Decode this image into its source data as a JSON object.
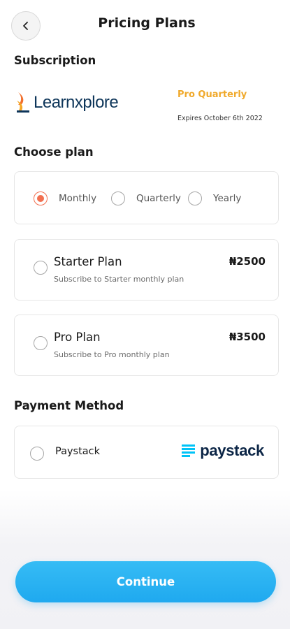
{
  "header": {
    "title": "Pricing Plans",
    "back_icon": "chevron-left-icon"
  },
  "subscription": {
    "section_label": "Subscription",
    "brand_name": "Learnxplore",
    "plan_name": "Pro Quarterly",
    "expiry": "Expires October 6th 2022"
  },
  "choose_plan": {
    "section_label": "Choose plan",
    "frequencies": [
      {
        "label": "Monthly",
        "selected": true
      },
      {
        "label": "Quarterly",
        "selected": false
      },
      {
        "label": "Yearly",
        "selected": false
      }
    ],
    "plans": [
      {
        "title": "Starter Plan",
        "description": "Subscribe to Starter monthly plan",
        "price": "₦2500",
        "selected": false
      },
      {
        "title": "Pro Plan",
        "description": "Subscribe to Pro monthly plan",
        "price": "₦3500",
        "selected": false
      }
    ]
  },
  "payment": {
    "section_label": "Payment Method",
    "method_label": "Paystack",
    "logo_text": "paystack",
    "selected": false
  },
  "footer": {
    "continue_label": "Continue"
  },
  "colors": {
    "accent_radio": "#f26f4f",
    "plan_highlight": "#f0a92b",
    "button": "#1fa9ef"
  }
}
